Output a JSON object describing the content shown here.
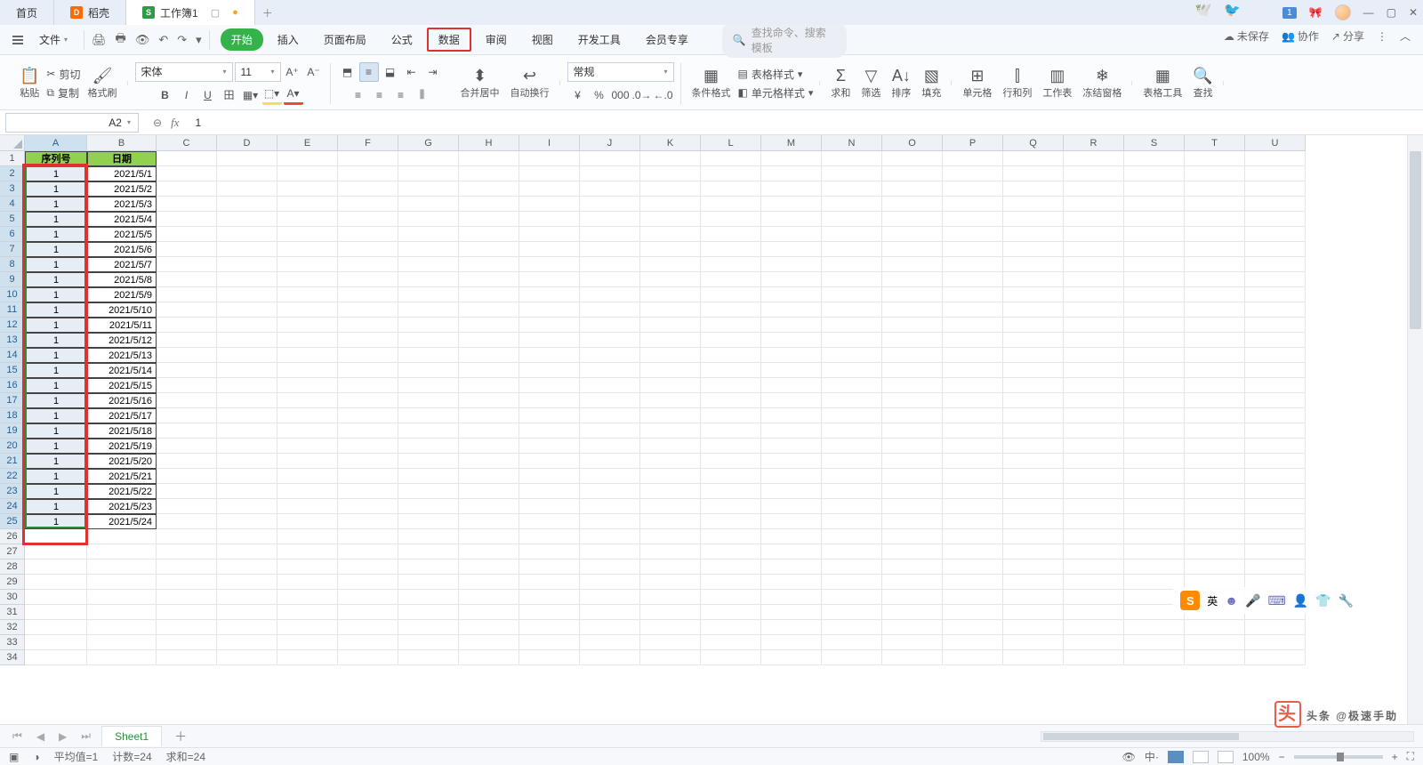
{
  "title_tabs": {
    "home": "首页",
    "daoke": "稻壳",
    "workbook": "工作簿1"
  },
  "win": {
    "badge": "1"
  },
  "file_label": "文件",
  "menu_tabs": [
    "开始",
    "插入",
    "页面布局",
    "公式",
    "数据",
    "审阅",
    "视图",
    "开发工具",
    "会员专享"
  ],
  "menu_active": 0,
  "menu_boxed": 4,
  "search_placeholder": "查找命令、搜索模板",
  "right_menu": {
    "unsaved": "未保存",
    "collab": "协作",
    "share": "分享"
  },
  "ribbon": {
    "paste": "粘贴",
    "cut": "剪切",
    "copy": "复制",
    "painter": "格式刷",
    "font": "宋体",
    "size": "11",
    "merge": "合并居中",
    "wrap": "自动换行",
    "numfmt": "常规",
    "condfmt": "条件格式",
    "tblstyle": "表格样式",
    "cellstyle": "单元格样式",
    "sum": "求和",
    "filter": "筛选",
    "sort": "排序",
    "fill": "填充",
    "cells": "单元格",
    "rowscols": "行和列",
    "worksheet": "工作表",
    "freeze": "冻结窗格",
    "tabletool": "表格工具",
    "find": "查找"
  },
  "namebox": "A2",
  "formula_value": "1",
  "columns": [
    "A",
    "B",
    "C",
    "D",
    "E",
    "F",
    "G",
    "H",
    "I",
    "J",
    "K",
    "L",
    "M",
    "N",
    "O",
    "P",
    "Q",
    "R",
    "S",
    "T",
    "U"
  ],
  "col_widths": {
    "A": 70,
    "B": 78,
    "default": 68
  },
  "sel_col": "A",
  "headers": {
    "A": "序列号",
    "B": "日期"
  },
  "data_rows": [
    {
      "A": "1",
      "B": "2021/5/1"
    },
    {
      "A": "1",
      "B": "2021/5/2"
    },
    {
      "A": "1",
      "B": "2021/5/3"
    },
    {
      "A": "1",
      "B": "2021/5/4"
    },
    {
      "A": "1",
      "B": "2021/5/5"
    },
    {
      "A": "1",
      "B": "2021/5/6"
    },
    {
      "A": "1",
      "B": "2021/5/7"
    },
    {
      "A": "1",
      "B": "2021/5/8"
    },
    {
      "A": "1",
      "B": "2021/5/9"
    },
    {
      "A": "1",
      "B": "2021/5/10"
    },
    {
      "A": "1",
      "B": "2021/5/11"
    },
    {
      "A": "1",
      "B": "2021/5/12"
    },
    {
      "A": "1",
      "B": "2021/5/13"
    },
    {
      "A": "1",
      "B": "2021/5/14"
    },
    {
      "A": "1",
      "B": "2021/5/15"
    },
    {
      "A": "1",
      "B": "2021/5/16"
    },
    {
      "A": "1",
      "B": "2021/5/17"
    },
    {
      "A": "1",
      "B": "2021/5/18"
    },
    {
      "A": "1",
      "B": "2021/5/19"
    },
    {
      "A": "1",
      "B": "2021/5/20"
    },
    {
      "A": "1",
      "B": "2021/5/21"
    },
    {
      "A": "1",
      "B": "2021/5/22"
    },
    {
      "A": "1",
      "B": "2021/5/23"
    },
    {
      "A": "1",
      "B": "2021/5/24"
    }
  ],
  "total_visible_rows": 34,
  "sel_range": {
    "r1": 2,
    "r2": 25
  },
  "sheet_tab": "Sheet1",
  "status": {
    "avg": "平均值=1",
    "count": "计数=24",
    "sum": "求和=24",
    "zoom": "100%"
  },
  "sogou_label": "英",
  "watermark": "头条 @极速手助"
}
